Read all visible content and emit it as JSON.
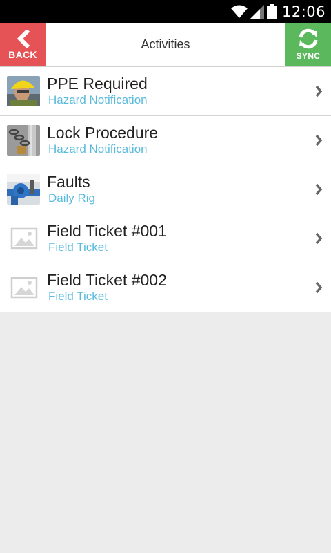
{
  "status_bar": {
    "time": "12:06",
    "icons": [
      "wifi-icon",
      "signal-icon",
      "battery-icon"
    ]
  },
  "header": {
    "title": "Activities",
    "back_label": "BACK",
    "sync_label": "SYNC",
    "back_color": "#e55356",
    "sync_color": "#5cb85c"
  },
  "activities": [
    {
      "name": "PPE Required",
      "type": "Hazard Notification",
      "thumbnail": "worker-hardhat-photo"
    },
    {
      "name": "Lock Procedure",
      "type": "Hazard Notification",
      "thumbnail": "chain-padlock-photo"
    },
    {
      "name": "Faults",
      "type": "Daily Rig",
      "thumbnail": "blue-valve-photo"
    },
    {
      "name": "Field Ticket #001",
      "type": "Field Ticket",
      "thumbnail": "image-placeholder-icon"
    },
    {
      "name": "Field Ticket #002",
      "type": "Field Ticket",
      "thumbnail": "image-placeholder-icon"
    }
  ],
  "colors": {
    "subtitle": "#5bbbdc",
    "background": "#ececec"
  }
}
